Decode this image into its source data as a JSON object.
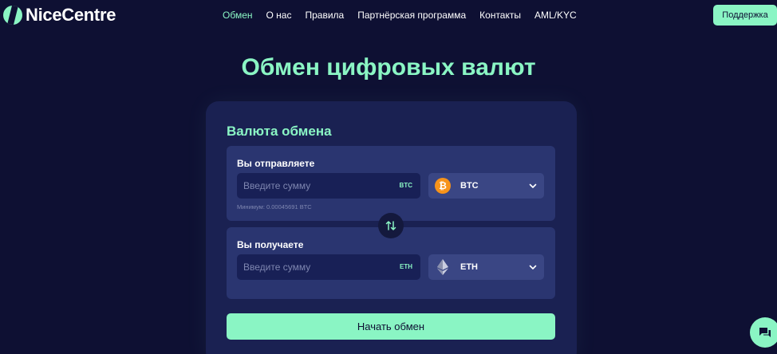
{
  "header": {
    "logo_text": "NiceCentre",
    "nav": [
      {
        "label": "Обмен",
        "active": true
      },
      {
        "label": "О нас"
      },
      {
        "label": "Правила"
      },
      {
        "label": "Партнёрская программа"
      },
      {
        "label": "Контакты"
      },
      {
        "label": "AML/KYC"
      }
    ],
    "support_label": "Поддержка"
  },
  "page_title": "Обмен цифровых валют",
  "exchange": {
    "title": "Валюта обмена",
    "send": {
      "label": "Вы отправляете",
      "placeholder": "Введите сумму",
      "unit": "BTC",
      "currency": {
        "code": "BTC",
        "icon": "bitcoin-icon"
      },
      "minimum": "Минимум: 0.00045691 BTC"
    },
    "receive": {
      "label": "Вы получаете",
      "placeholder": "Введите сумму",
      "unit": "ETH",
      "currency": {
        "code": "ETH",
        "icon": "ethereum-icon"
      }
    },
    "swap_icon": "swap-arrows-icon",
    "submit_label": "Начать обмен"
  },
  "chat_icon": "chat-icon",
  "colors": {
    "background": "#0e1033",
    "accent": "#8af5c4",
    "card": "#1a2152",
    "panel": "#2a3570",
    "bitcoin": "#f7931a"
  }
}
